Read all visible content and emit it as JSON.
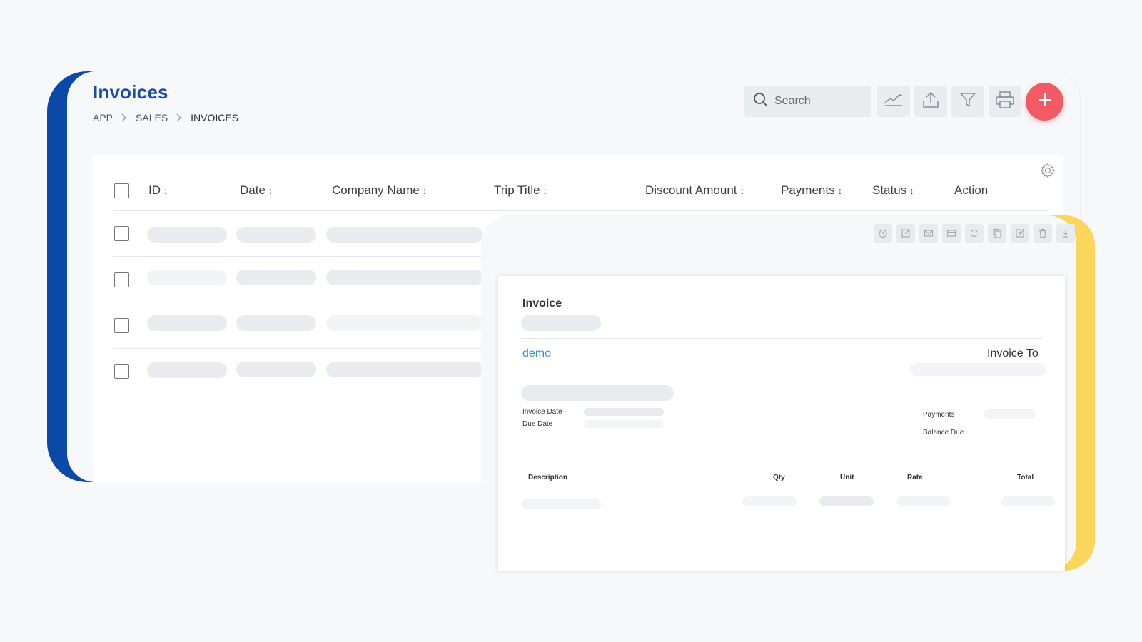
{
  "page": {
    "title": "Invoices",
    "breadcrumb": [
      "APP",
      "SALES",
      "INVOICES"
    ]
  },
  "toolbar": {
    "search_placeholder": "Search",
    "buttons": [
      "chart-icon",
      "upload-icon",
      "filter-icon",
      "printer-icon"
    ],
    "add_icon": "plus-icon"
  },
  "table": {
    "columns": [
      "ID",
      "Date",
      "Company Name",
      "Trip Title",
      "Discount Amount",
      "Payments",
      "Status",
      "Action"
    ],
    "sort_glyph": "↕",
    "row_count": 4
  },
  "preview": {
    "actions": [
      "clock-icon",
      "share-icon",
      "mail-icon",
      "card-icon",
      "refresh-icon",
      "copy-icon",
      "edit-icon",
      "trash-icon",
      "download-icon"
    ],
    "invoice_label": "Invoice",
    "company": "demo",
    "invoice_to": "Invoice To",
    "invoice_date_label": "Invoice Date",
    "due_date_label": "Due Date",
    "payments_label": "Payments",
    "balance_due_label": "Balance Due",
    "line_headers": {
      "description": "Description",
      "qty": "Qty",
      "unit": "Unit",
      "rate": "Rate",
      "total": "Total"
    }
  },
  "colors": {
    "accent_blue": "#0b48a8",
    "title_blue": "#1d4ca6",
    "add_red": "#f25a65",
    "accent_yellow": "#fbd65c",
    "link_blue": "#3b8fd0"
  }
}
